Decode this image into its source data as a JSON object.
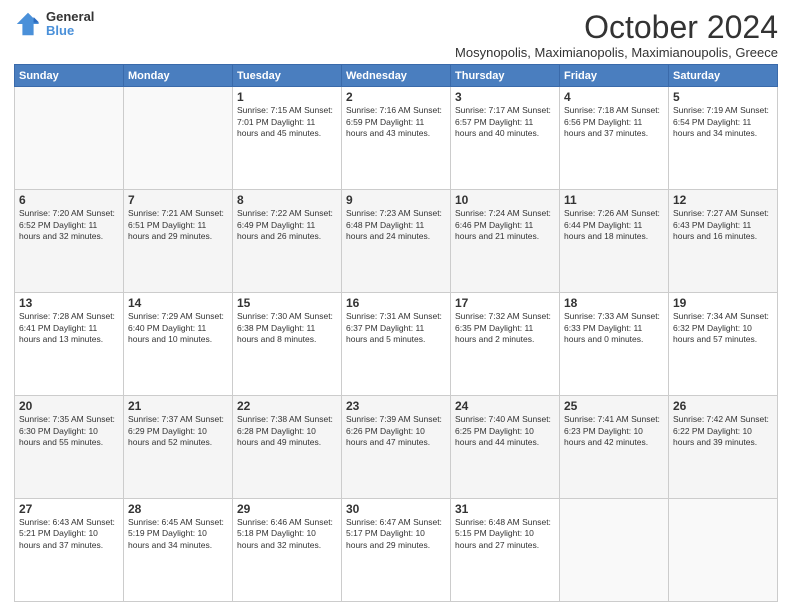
{
  "logo": {
    "general": "General",
    "blue": "Blue"
  },
  "title": "October 2024",
  "subtitle": "Mosynopolis, Maximianopolis, Maximianoupolis, Greece",
  "days_of_week": [
    "Sunday",
    "Monday",
    "Tuesday",
    "Wednesday",
    "Thursday",
    "Friday",
    "Saturday"
  ],
  "weeks": [
    [
      {
        "day": "",
        "info": ""
      },
      {
        "day": "",
        "info": ""
      },
      {
        "day": "1",
        "info": "Sunrise: 7:15 AM\nSunset: 7:01 PM\nDaylight: 11 hours and 45 minutes."
      },
      {
        "day": "2",
        "info": "Sunrise: 7:16 AM\nSunset: 6:59 PM\nDaylight: 11 hours and 43 minutes."
      },
      {
        "day": "3",
        "info": "Sunrise: 7:17 AM\nSunset: 6:57 PM\nDaylight: 11 hours and 40 minutes."
      },
      {
        "day": "4",
        "info": "Sunrise: 7:18 AM\nSunset: 6:56 PM\nDaylight: 11 hours and 37 minutes."
      },
      {
        "day": "5",
        "info": "Sunrise: 7:19 AM\nSunset: 6:54 PM\nDaylight: 11 hours and 34 minutes."
      }
    ],
    [
      {
        "day": "6",
        "info": "Sunrise: 7:20 AM\nSunset: 6:52 PM\nDaylight: 11 hours and 32 minutes."
      },
      {
        "day": "7",
        "info": "Sunrise: 7:21 AM\nSunset: 6:51 PM\nDaylight: 11 hours and 29 minutes."
      },
      {
        "day": "8",
        "info": "Sunrise: 7:22 AM\nSunset: 6:49 PM\nDaylight: 11 hours and 26 minutes."
      },
      {
        "day": "9",
        "info": "Sunrise: 7:23 AM\nSunset: 6:48 PM\nDaylight: 11 hours and 24 minutes."
      },
      {
        "day": "10",
        "info": "Sunrise: 7:24 AM\nSunset: 6:46 PM\nDaylight: 11 hours and 21 minutes."
      },
      {
        "day": "11",
        "info": "Sunrise: 7:26 AM\nSunset: 6:44 PM\nDaylight: 11 hours and 18 minutes."
      },
      {
        "day": "12",
        "info": "Sunrise: 7:27 AM\nSunset: 6:43 PM\nDaylight: 11 hours and 16 minutes."
      }
    ],
    [
      {
        "day": "13",
        "info": "Sunrise: 7:28 AM\nSunset: 6:41 PM\nDaylight: 11 hours and 13 minutes."
      },
      {
        "day": "14",
        "info": "Sunrise: 7:29 AM\nSunset: 6:40 PM\nDaylight: 11 hours and 10 minutes."
      },
      {
        "day": "15",
        "info": "Sunrise: 7:30 AM\nSunset: 6:38 PM\nDaylight: 11 hours and 8 minutes."
      },
      {
        "day": "16",
        "info": "Sunrise: 7:31 AM\nSunset: 6:37 PM\nDaylight: 11 hours and 5 minutes."
      },
      {
        "day": "17",
        "info": "Sunrise: 7:32 AM\nSunset: 6:35 PM\nDaylight: 11 hours and 2 minutes."
      },
      {
        "day": "18",
        "info": "Sunrise: 7:33 AM\nSunset: 6:33 PM\nDaylight: 11 hours and 0 minutes."
      },
      {
        "day": "19",
        "info": "Sunrise: 7:34 AM\nSunset: 6:32 PM\nDaylight: 10 hours and 57 minutes."
      }
    ],
    [
      {
        "day": "20",
        "info": "Sunrise: 7:35 AM\nSunset: 6:30 PM\nDaylight: 10 hours and 55 minutes."
      },
      {
        "day": "21",
        "info": "Sunrise: 7:37 AM\nSunset: 6:29 PM\nDaylight: 10 hours and 52 minutes."
      },
      {
        "day": "22",
        "info": "Sunrise: 7:38 AM\nSunset: 6:28 PM\nDaylight: 10 hours and 49 minutes."
      },
      {
        "day": "23",
        "info": "Sunrise: 7:39 AM\nSunset: 6:26 PM\nDaylight: 10 hours and 47 minutes."
      },
      {
        "day": "24",
        "info": "Sunrise: 7:40 AM\nSunset: 6:25 PM\nDaylight: 10 hours and 44 minutes."
      },
      {
        "day": "25",
        "info": "Sunrise: 7:41 AM\nSunset: 6:23 PM\nDaylight: 10 hours and 42 minutes."
      },
      {
        "day": "26",
        "info": "Sunrise: 7:42 AM\nSunset: 6:22 PM\nDaylight: 10 hours and 39 minutes."
      }
    ],
    [
      {
        "day": "27",
        "info": "Sunrise: 6:43 AM\nSunset: 5:21 PM\nDaylight: 10 hours and 37 minutes."
      },
      {
        "day": "28",
        "info": "Sunrise: 6:45 AM\nSunset: 5:19 PM\nDaylight: 10 hours and 34 minutes."
      },
      {
        "day": "29",
        "info": "Sunrise: 6:46 AM\nSunset: 5:18 PM\nDaylight: 10 hours and 32 minutes."
      },
      {
        "day": "30",
        "info": "Sunrise: 6:47 AM\nSunset: 5:17 PM\nDaylight: 10 hours and 29 minutes."
      },
      {
        "day": "31",
        "info": "Sunrise: 6:48 AM\nSunset: 5:15 PM\nDaylight: 10 hours and 27 minutes."
      },
      {
        "day": "",
        "info": ""
      },
      {
        "day": "",
        "info": ""
      }
    ]
  ]
}
